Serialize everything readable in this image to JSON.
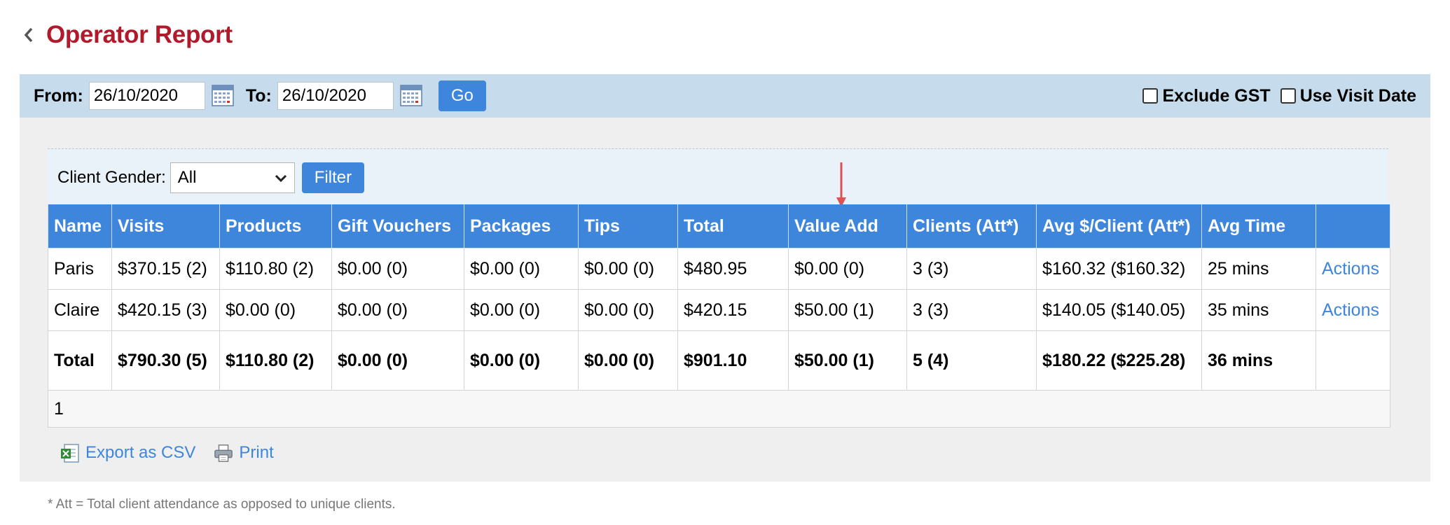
{
  "header": {
    "title": "Operator Report"
  },
  "datebar": {
    "from_label": "From:",
    "from_value": "26/10/2020",
    "to_label": "To:",
    "to_value": "26/10/2020",
    "go_label": "Go",
    "exclude_gst_label": "Exclude GST",
    "use_visit_date_label": "Use Visit Date"
  },
  "filter": {
    "gender_label": "Client Gender:",
    "gender_selected": "All",
    "filter_label": "Filter"
  },
  "table": {
    "columns": [
      "Name",
      "Visits",
      "Products",
      "Gift Vouchers",
      "Packages",
      "Tips",
      "Total",
      "Value Add",
      "Clients (Att*)",
      "Avg $/Client (Att*)",
      "Avg Time",
      ""
    ],
    "rows": [
      [
        "Paris",
        "$370.15 (2)",
        "$110.80 (2)",
        "$0.00 (0)",
        "$0.00 (0)",
        "$0.00 (0)",
        "$480.95",
        "$0.00 (0)",
        "3 (3)",
        "$160.32 ($160.32)",
        "25 mins",
        "Actions"
      ],
      [
        "Claire",
        "$420.15 (3)",
        "$0.00 (0)",
        "$0.00 (0)",
        "$0.00 (0)",
        "$0.00 (0)",
        "$420.15",
        "$50.00 (1)",
        "3 (3)",
        "$140.05 ($140.05)",
        "35 mins",
        "Actions"
      ]
    ],
    "total": [
      "Total",
      "$790.30 (5)",
      "$110.80 (2)",
      "$0.00 (0)",
      "$0.00 (0)",
      "$0.00 (0)",
      "$901.10",
      "$50.00 (1)",
      "5 (4)",
      "$180.22 ($225.28)",
      "36 mins",
      ""
    ],
    "page": "1"
  },
  "export": {
    "csv_label": "Export as CSV",
    "print_label": "Print"
  },
  "footnote": "* Att = Total client attendance as opposed to unique clients."
}
